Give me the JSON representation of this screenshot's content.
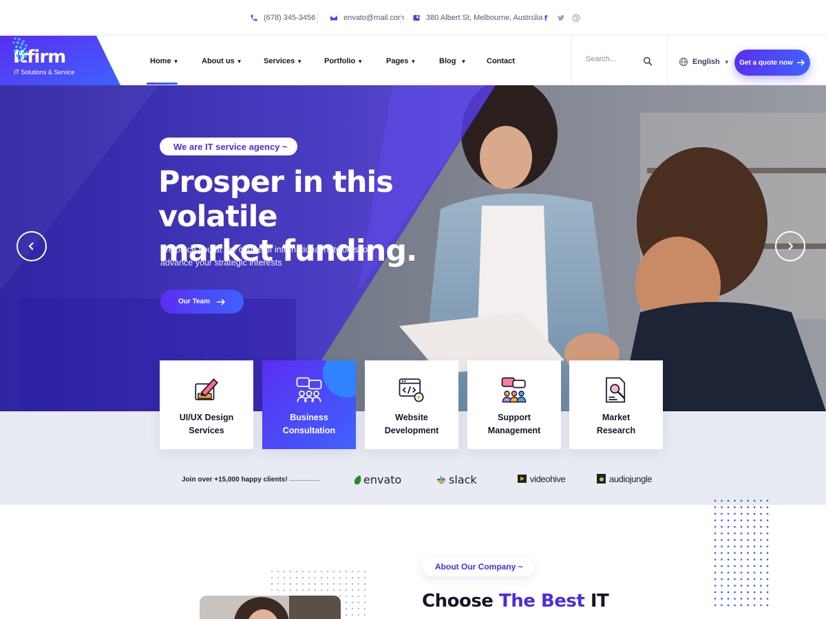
{
  "topbar": {
    "phone": "(678) 345-3456",
    "email": "envato@mail.com",
    "address": "380 Albert St, Melbourne, Australia",
    "social": [
      "facebook-icon",
      "twitter-icon",
      "dribbble-icon"
    ]
  },
  "header": {
    "logo": {
      "name": "Itfirm",
      "tagline": "IT Solutions & Service"
    },
    "nav": [
      {
        "label": "Home",
        "has_dropdown": true,
        "active": true
      },
      {
        "label": "About us",
        "has_dropdown": true
      },
      {
        "label": "Services",
        "has_dropdown": true
      },
      {
        "label": "Portfolio",
        "has_dropdown": true
      },
      {
        "label": "Pages",
        "has_dropdown": true
      },
      {
        "label": "Blog",
        "has_dropdown": true
      },
      {
        "label": "Contact",
        "has_dropdown": false
      }
    ],
    "search": {
      "placeholder": "Search..."
    },
    "language": "English",
    "cta": "Get a quote now"
  },
  "hero": {
    "badge": "We are IT service agency ~",
    "title_line1": "Prosper in this volatile",
    "title_line2": "market funding.",
    "text": "We place you at the centre of international networks to advance your strategic interests",
    "button": "Our Team"
  },
  "services": [
    {
      "line1": "UI/UX Design",
      "line2": "Services",
      "icon": "design-icon"
    },
    {
      "line1": "Business",
      "line2": "Consultation",
      "icon": "consultation-icon",
      "active": true
    },
    {
      "line1": "Website",
      "line2": "Development",
      "icon": "web-dev-icon"
    },
    {
      "line1": "Support",
      "line2": "Management",
      "icon": "support-icon"
    },
    {
      "line1": "Market",
      "line2": "Research",
      "icon": "research-icon"
    }
  ],
  "clients": {
    "text": "Join over +15,000 happy clients!",
    "logos": [
      "envato",
      "slack",
      "videohive",
      "audiojungle"
    ]
  },
  "about": {
    "badge": "About Our Company ~",
    "title_part1": "Choose ",
    "title_accent": "The Best",
    "title_part2": " IT"
  },
  "colors": {
    "accent": "#4b2de0",
    "gradient_start": "#5a2ef0",
    "gradient_end": "#3f62ff",
    "band": "#e9ebf2"
  }
}
